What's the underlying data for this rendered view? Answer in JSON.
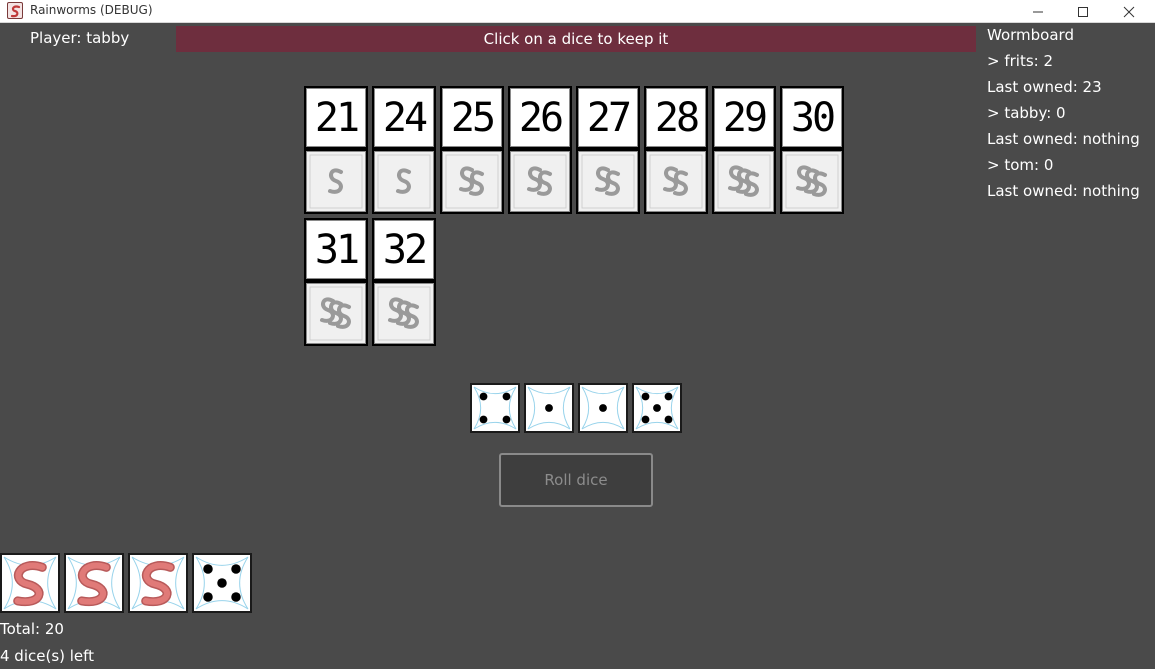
{
  "window": {
    "title": "Rainworms (DEBUG)",
    "icon": "worm-app-icon",
    "controls": [
      "minimize-icon",
      "maximize-icon",
      "close-icon"
    ]
  },
  "header": {
    "player": "Player: tabby",
    "message": "Click on a dice to keep it"
  },
  "wormboard": {
    "title": "Wormboard",
    "lines": [
      "> frits: 2",
      "Last owned: 23",
      "> tabby: 0",
      "Last owned: nothing",
      "> tom: 0",
      "Last owned: nothing"
    ]
  },
  "tiles": [
    {
      "number": "21",
      "worms": 1
    },
    {
      "number": "24",
      "worms": 1
    },
    {
      "number": "25",
      "worms": 2
    },
    {
      "number": "26",
      "worms": 2
    },
    {
      "number": "27",
      "worms": 2
    },
    {
      "number": "28",
      "worms": 2
    },
    {
      "number": "29",
      "worms": 3
    },
    {
      "number": "30",
      "worms": 3
    },
    {
      "number": "31",
      "worms": 3
    },
    {
      "number": "32",
      "worms": 3
    }
  ],
  "rolled_dice": [
    4,
    1,
    1,
    5
  ],
  "roll_button": "Roll dice",
  "kept_dice": [
    "worm",
    "worm",
    "worm",
    5
  ],
  "footer": {
    "total": "Total: 20",
    "dice_left": "4 dice(s) left"
  },
  "colors": {
    "background": "#4a4a4a",
    "message_bar": "#6e2e3e",
    "worm": "#e07a78",
    "die_pattern": "#7ec8e6"
  }
}
